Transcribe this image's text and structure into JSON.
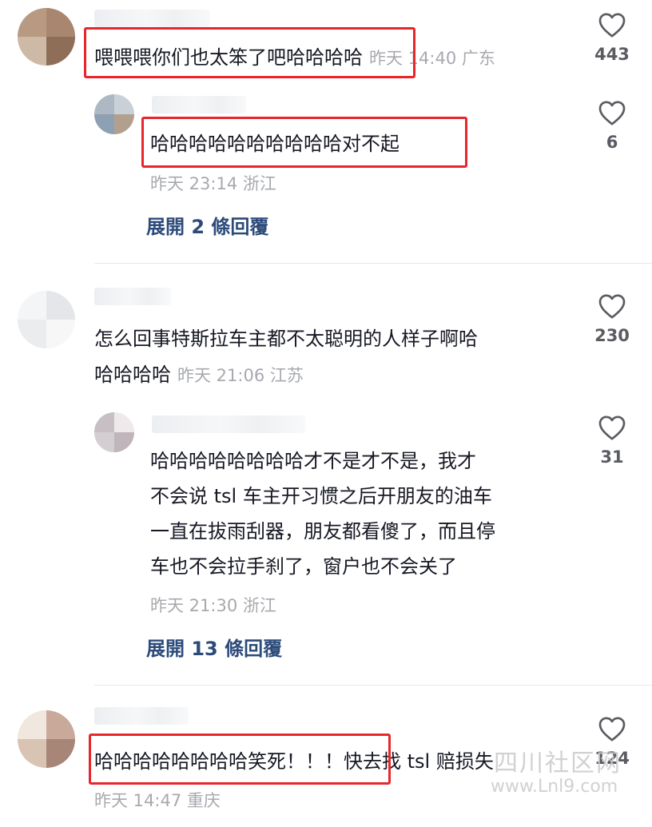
{
  "comments": [
    {
      "text": "喂喂喂你们也太笨了吧哈哈哈哈",
      "meta": "昨天 14:40 广东",
      "likes": "443",
      "replies": [
        {
          "text": "哈哈哈哈哈哈哈哈哈哈对不起",
          "meta": "昨天 23:14 浙江",
          "likes": "6",
          "expand": "展開 2 條回覆"
        }
      ]
    },
    {
      "text_line1": "怎么回事特斯拉车主都不太聪明的人样子啊哈",
      "text_line2": "哈哈哈哈",
      "meta": "昨天 21:06 江苏",
      "likes": "230",
      "replies": [
        {
          "lines": [
            "哈哈哈哈哈哈哈哈才不是才不是，我才",
            "不会说 tsl 车主开习惯之后开朋友的油车",
            "一直在拔雨刮器，朋友都看傻了，而且停",
            "车也不会拉手刹了，窗户也不会关了"
          ],
          "meta": "昨天 21:30 浙江",
          "likes": "31",
          "expand": "展開 13 條回覆"
        }
      ]
    },
    {
      "text": "哈哈哈哈哈哈哈哈笑死！！！快去找 tsl 赔损失",
      "meta": "昨天 14:47 重庆",
      "likes": "124"
    }
  ],
  "watermark": {
    "line1": "四川社区网",
    "line2": "www.Lnl9.com"
  },
  "colors": {
    "highlight": "#e8262b",
    "meta": "#a7a9ae",
    "expand": "#2c4a7a",
    "text": "#161823"
  },
  "icons": {
    "like": "heart-outline-icon"
  }
}
